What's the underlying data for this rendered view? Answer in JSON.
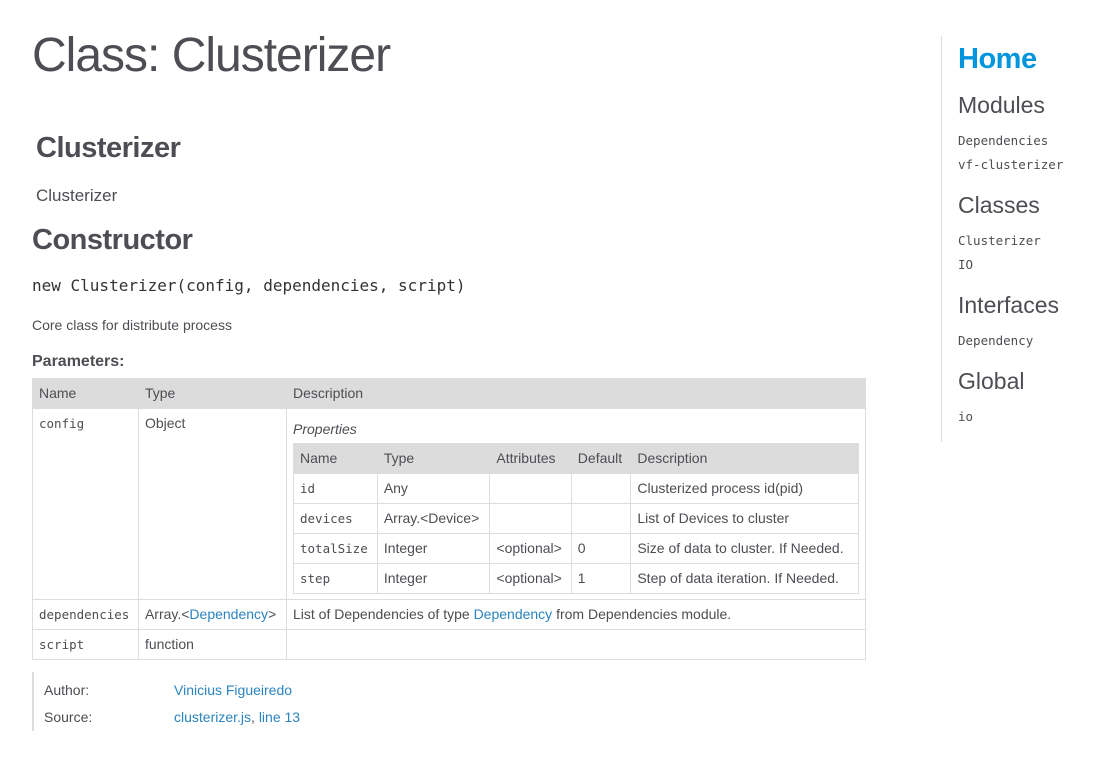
{
  "page": {
    "title": "Class: Clusterizer"
  },
  "class_header": {
    "name": "Clusterizer",
    "description": "Clusterizer"
  },
  "constructor": {
    "heading": "Constructor",
    "signature": "new Clusterizer(config, dependencies, script)",
    "description": "Core class for distribute process",
    "params_heading": "Parameters:",
    "columns": [
      "Name",
      "Type",
      "Description"
    ],
    "params": [
      {
        "name": "config",
        "type": "Object",
        "properties_label": "Properties",
        "properties_columns": [
          "Name",
          "Type",
          "Attributes",
          "Default",
          "Description"
        ],
        "properties": [
          {
            "name": "id",
            "type": "Any",
            "attributes": "",
            "default": "",
            "description": "Clusterized process id(pid)"
          },
          {
            "name": "devices",
            "type": "Array.<Device>",
            "attributes": "",
            "default": "",
            "description": "List of Devices to cluster"
          },
          {
            "name": "totalSize",
            "type": "Integer",
            "attributes": "<optional>",
            "default": "0",
            "description": "Size of data to cluster. If Needed."
          },
          {
            "name": "step",
            "type": "Integer",
            "attributes": "<optional>",
            "default": "1",
            "description": "Step of data iteration. If Needed."
          }
        ]
      },
      {
        "name": "dependencies",
        "type_prefix": "Array.<",
        "type_link": "Dependency",
        "type_suffix": ">",
        "desc_prefix": "List of Dependencies of type ",
        "desc_link": "Dependency",
        "desc_suffix": " from Dependencies module."
      },
      {
        "name": "script",
        "type": "function",
        "description": ""
      }
    ],
    "details": {
      "author_label": "Author:",
      "author": "Vinicius Figueiredo",
      "source_label": "Source:",
      "source_file": "clusterizer.js",
      "source_sep": ", ",
      "source_line": "line 13"
    }
  },
  "nav": {
    "home": "Home",
    "sections": [
      {
        "heading": "Modules",
        "items": [
          "Dependencies",
          "vf-clusterizer"
        ]
      },
      {
        "heading": "Classes",
        "items": [
          "Clusterizer",
          "IO"
        ]
      },
      {
        "heading": "Interfaces",
        "items": [
          "Dependency"
        ]
      },
      {
        "heading": "Global",
        "items": [
          "io"
        ]
      }
    ]
  },
  "colors": {
    "link": "#2a84c0",
    "home": "#0095dd",
    "text": "#4d4e53",
    "header_bg": "#dcdcdc"
  }
}
